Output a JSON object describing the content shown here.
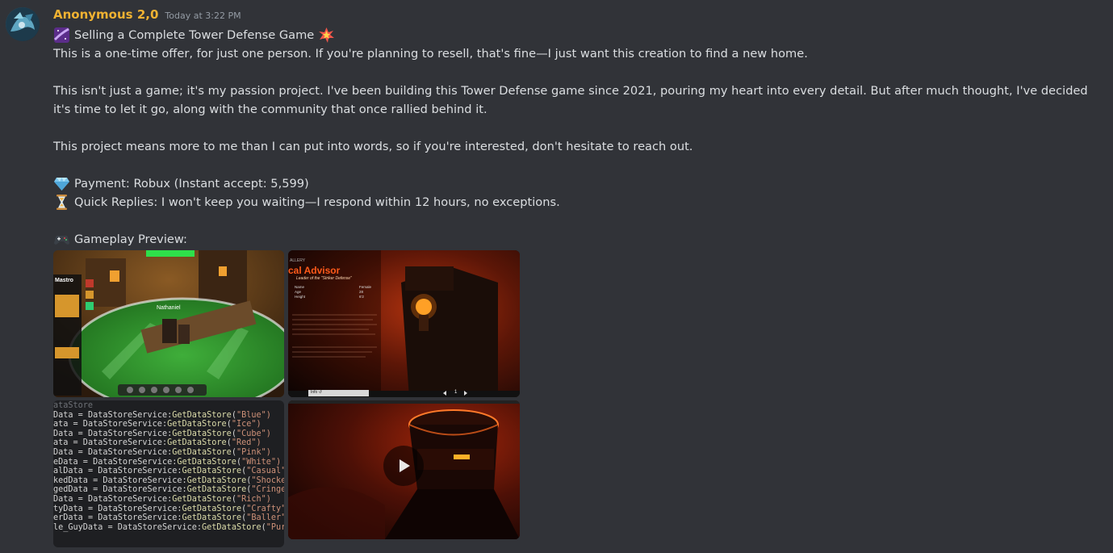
{
  "message": {
    "author": "Anonymous 2,0",
    "timestamp": "Today at 3:22 PM",
    "author_color": "#f0b232",
    "lines": {
      "title": "Selling a Complete Tower Defense Game",
      "title_emoji_before": "milky-way-icon",
      "title_emoji_after": "collision-icon",
      "p1": "This is a one-time offer, for just one person. If you're planning to resell, that's fine—I just want this creation to find a new home.",
      "p2": "This isn't just a game; it's my passion project. I've been building this Tower Defense game since 2021, pouring my heart into every detail. But after much thought, I've decided it's time to let it go, along with the community that once rallied behind it.",
      "p3": "This project means more to me than I can put into words, so if you're interested, don't hesitate to reach out.",
      "payment": "Payment: Robux (Instant accept: 5,599)",
      "payment_emoji": "gem-icon",
      "replies": "Quick Replies: I won't keep you waiting—I respond within 12 hours, no exceptions.",
      "replies_emoji": "hourglass-icon",
      "preview": "Gameplay Preview:",
      "preview_emoji": "game-controller-icon"
    }
  },
  "gallery": {
    "tile1": {
      "player_name": "Nathaniel",
      "left_panel_label": "Mastro"
    },
    "tile2": {
      "header": "ALLERY",
      "title": "cal Advisor",
      "subtitle": "Leader of the \"Striker Defense\"",
      "stats_left": [
        "Name",
        "Age",
        "Height"
      ],
      "stats_right": [
        "Female",
        "28",
        "6'2"
      ],
      "pager": "1",
      "button": "Info ↺"
    },
    "tile3": {
      "header": "ataStore",
      "rows": [
        {
          "var": "Data",
          "store": "\"Blue\")"
        },
        {
          "var": "ata",
          "store": "\"Ice\")"
        },
        {
          "var": "Data",
          "store": "\"Cube\")"
        },
        {
          "var": "ata",
          "store": "\"Red\")"
        },
        {
          "var": "Data",
          "store": "\"Pink\")"
        },
        {
          "var": "eData",
          "store": "\"White\")"
        },
        {
          "var": "alData",
          "store": "\"Casual\""
        },
        {
          "var": "kedData",
          "store": "\"Shocke"
        },
        {
          "var": "gedData",
          "store": "\"Cringe"
        },
        {
          "var": "Data",
          "store": "\"Rich\")"
        },
        {
          "var": "tyData",
          "store": "\"Crafty\""
        },
        {
          "var": "erData",
          "store": "\"Baller\""
        },
        {
          "var": "le_GuyData",
          "store": "\"Pur"
        }
      ],
      "assign": " = DataStoreService:",
      "call": "GetDataStore",
      "open_paren": "("
    },
    "tile4": {
      "play_icon": "play-icon"
    }
  }
}
